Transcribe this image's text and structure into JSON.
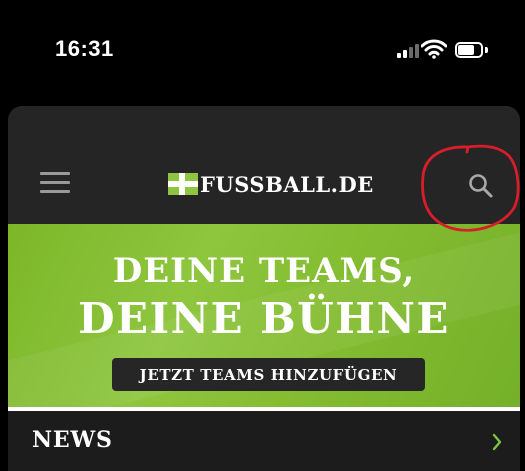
{
  "status_bar": {
    "time": "16:31",
    "signal_icon": "cellular-signal-icon",
    "wifi_icon": "wifi-icon",
    "battery_icon": "battery-icon",
    "battery_level": 0.6
  },
  "header": {
    "menu_icon": "hamburger-menu-icon",
    "logo_text": "FUSSBALL.DE",
    "search_icon": "search-icon"
  },
  "banner": {
    "line1": "DEINE TEAMS,",
    "line2": "DEINE BÜHNE",
    "cta_label": "JETZT TEAMS HINZUFÜGEN"
  },
  "news": {
    "title": "NEWS",
    "chevron_icon": "chevron-right-icon"
  },
  "colors": {
    "header_bg": "#252525",
    "banner_green": "#8ec63f",
    "cta_bg": "#262626",
    "news_chevron": "#7cc243",
    "annotation_red": "#d81e2a"
  }
}
